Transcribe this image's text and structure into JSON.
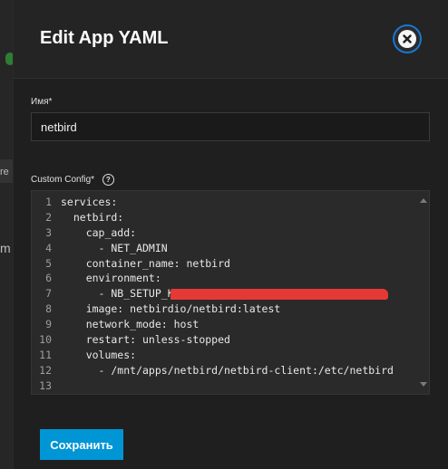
{
  "dialog": {
    "title": "Edit App YAML",
    "close_icon": "close-circle-icon"
  },
  "form": {
    "name_label": "Имя",
    "name_value": "netbird",
    "config_label": "Custom Config",
    "required_mark": "*",
    "help_icon_char": "?"
  },
  "editor": {
    "lines": [
      {
        "no": "1",
        "text": "services:"
      },
      {
        "no": "2",
        "text": "  netbird:"
      },
      {
        "no": "3",
        "text": "    cap_add:"
      },
      {
        "no": "4",
        "text": "      - NET_ADMIN"
      },
      {
        "no": "5",
        "text": "    container_name: netbird"
      },
      {
        "no": "6",
        "text": "    environment:"
      },
      {
        "no": "7",
        "text": "      - NB_SETUP_KEY="
      },
      {
        "no": "8",
        "text": "    image: netbirdio/netbird:latest"
      },
      {
        "no": "9",
        "text": "    network_mode: host"
      },
      {
        "no": "10",
        "text": "    restart: unless-stopped"
      },
      {
        "no": "11",
        "text": "    volumes:"
      },
      {
        "no": "12",
        "text": "      - /mnt/apps/netbird/netbird-client:/etc/netbird"
      },
      {
        "no": "13",
        "text": ""
      }
    ]
  },
  "actions": {
    "save_label": "Сохранить"
  },
  "background": {
    "letters": [
      "re",
      "m"
    ]
  },
  "colors": {
    "accent": "#0095d5",
    "redaction": "#e53935"
  }
}
